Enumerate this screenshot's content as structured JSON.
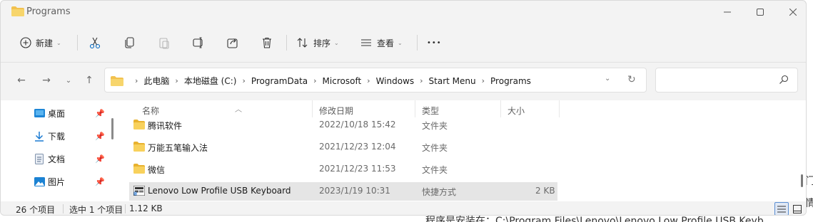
{
  "window": {
    "title": "Programs"
  },
  "title_controls": {
    "minimize": "–",
    "maximize": "☐",
    "close": "✕"
  },
  "toolbar": {
    "new_label": "新建",
    "sort_label": "排序",
    "view_label": "查看",
    "more_label": "•••"
  },
  "nav": {
    "back": "←",
    "forward": "→",
    "recent": "⌄",
    "up": "↑"
  },
  "breadcrumb": [
    "此电脑",
    "本地磁盘 (C:)",
    "ProgramData",
    "Microsoft",
    "Windows",
    "Start Menu",
    "Programs"
  ],
  "search": {
    "placeholder": ""
  },
  "sidebar": {
    "items": [
      {
        "label": "桌面",
        "icon": "desktop-icon",
        "pinned": true
      },
      {
        "label": "下载",
        "icon": "download-icon",
        "pinned": true
      },
      {
        "label": "文档",
        "icon": "document-icon",
        "pinned": true
      },
      {
        "label": "图片",
        "icon": "picture-icon",
        "pinned": true
      }
    ]
  },
  "file_list": {
    "columns": [
      "名称",
      "修改日期",
      "类型",
      "大小"
    ],
    "rows": [
      {
        "name": "腾讯软件",
        "date": "2022/10/18 15:42",
        "type": "文件夹",
        "size": "",
        "icon": "folder-icon",
        "selected": false
      },
      {
        "name": "万能五笔输入法",
        "date": "2021/12/23 12:04",
        "type": "文件夹",
        "size": "",
        "icon": "folder-icon",
        "selected": false
      },
      {
        "name": "微信",
        "date": "2021/12/23 11:53",
        "type": "文件夹",
        "size": "",
        "icon": "folder-icon",
        "selected": false
      },
      {
        "name": "Lenovo Low Profile USB Keyboard",
        "date": "2023/1/19 10:31",
        "type": "快捷方式",
        "size": "2 KB",
        "icon": "shortcut-icon",
        "selected": true
      }
    ]
  },
  "status": {
    "item_count": "26 个项目",
    "selected": "选中 1 个项目",
    "selected_size": "1.12 KB"
  },
  "background": {
    "bottom_text": "程序是安装在：C:\\Program Files\\Lenovo\\Lenovo Low Profile USB Keyb",
    "edge_1": "门",
    "edge_2": "情"
  },
  "colors": {
    "folder": "#f2c14e",
    "accent": "#0067c0",
    "selected_row": "#e5e5e5"
  }
}
